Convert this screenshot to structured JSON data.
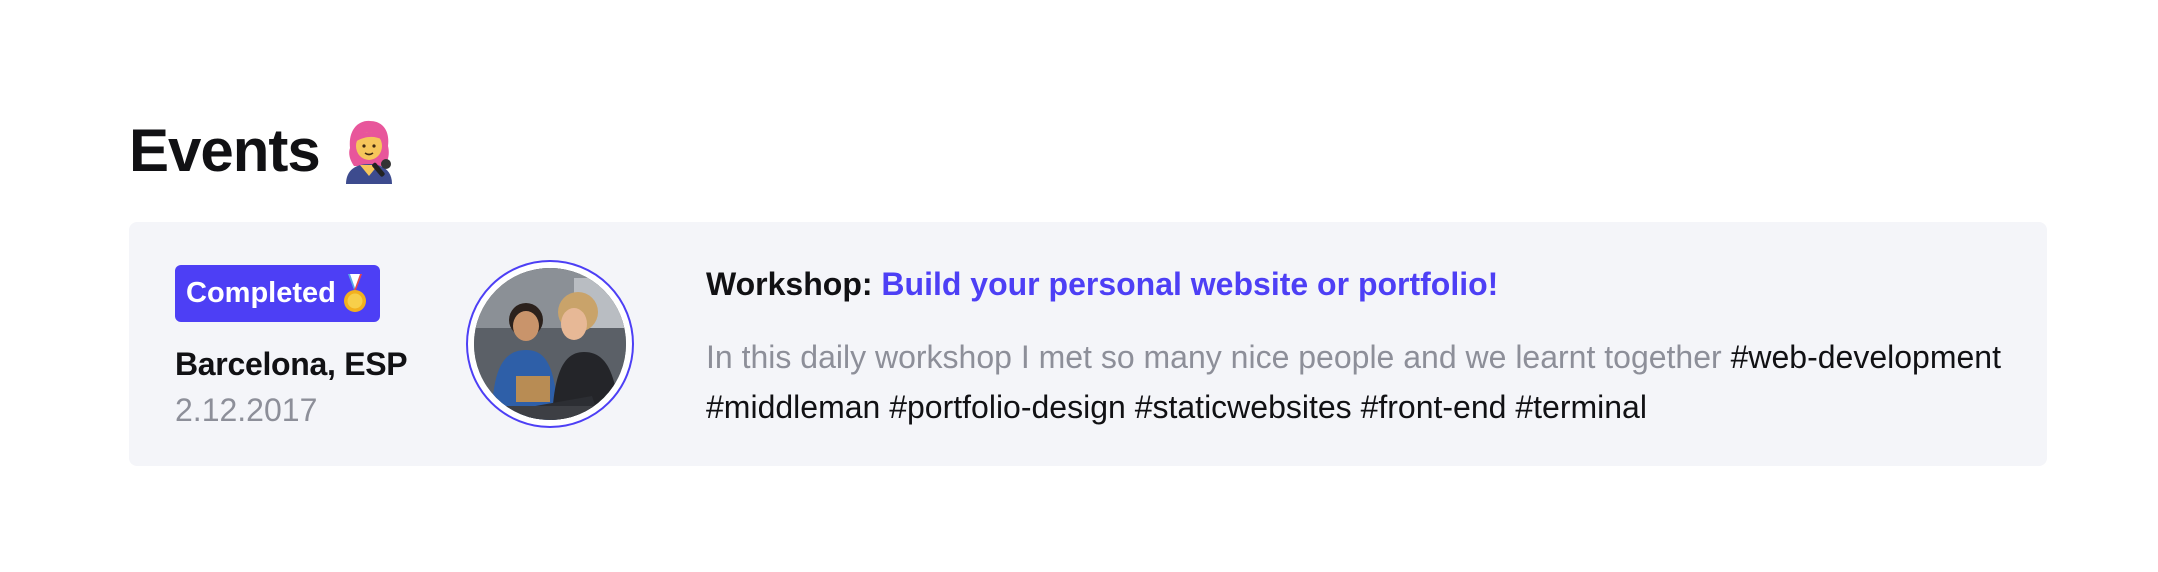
{
  "section": {
    "title": "Events",
    "title_icon": "singer-woman-emoji"
  },
  "event": {
    "status": "Completed",
    "status_icon": "medal-icon",
    "location": "Barcelona, ESP",
    "date": "2.12.2017",
    "image_alt": "people at a workshop with laptops",
    "type_label": "Workshop:",
    "title": "Build your personal website or portfolio!",
    "description": "In this daily workshop I met so many nice people and we learnt together",
    "tags": [
      "#web-development",
      "#middleman",
      "#portfolio-design",
      "#staticwebsites",
      "#front-end",
      "#terminal"
    ]
  },
  "colors": {
    "accent": "#4d3ff5",
    "card_background": "#f4f5f9",
    "muted_text": "#8d8f99",
    "text": "#111114"
  }
}
